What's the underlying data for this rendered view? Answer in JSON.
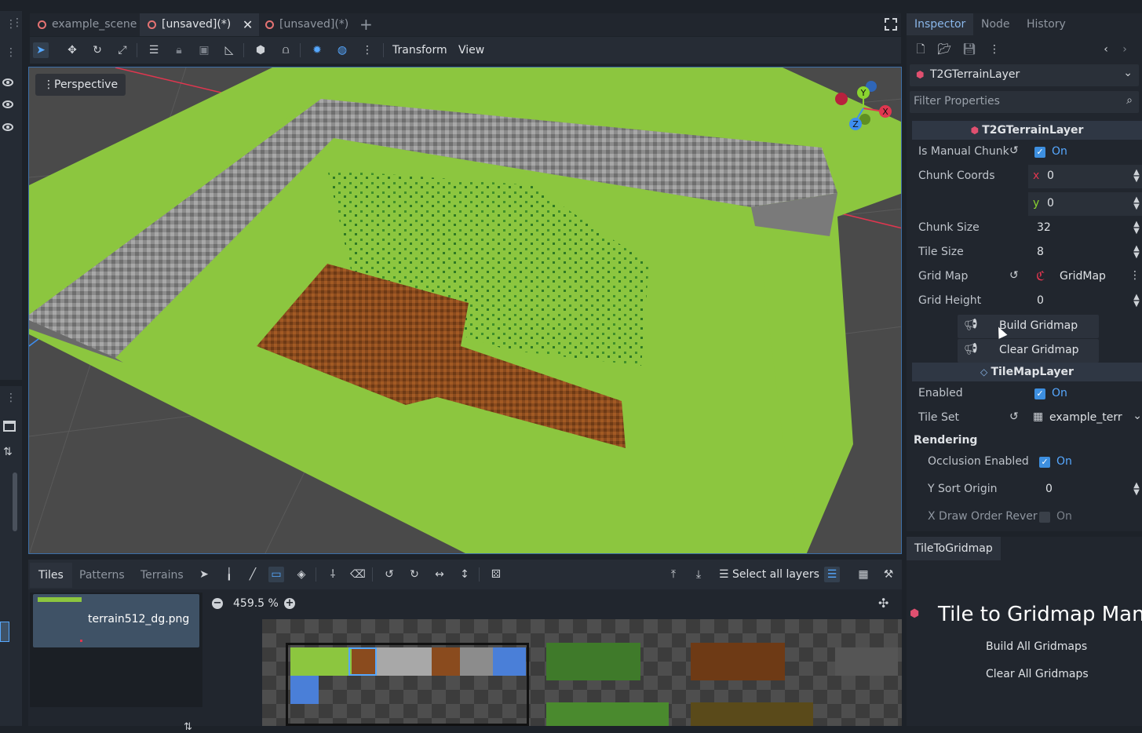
{
  "editor": {
    "scene_tabs": [
      "example_scene",
      "[unsaved](*)",
      "[unsaved](*)"
    ],
    "active_tab_index": 1,
    "toolbar_menus": [
      "Transform",
      "View"
    ],
    "viewport_mode": "Perspective",
    "gizmo_axes": [
      "Y",
      "X",
      "Z"
    ]
  },
  "bottom_panel": {
    "tabs": [
      "Tiles",
      "Patterns",
      "Terrains"
    ],
    "active_tab": "Tiles",
    "layers_button": "Select all layers",
    "atlas_name": "terrain512_dg.png",
    "zoom": "459.5 %"
  },
  "inspector": {
    "tabs": [
      "Inspector",
      "Node",
      "History"
    ],
    "active_tab": "Inspector",
    "object_name": "T2GTerrainLayer",
    "filter_placeholder": "Filter Properties",
    "section_main": "T2GTerrainLayer",
    "is_manual_chunk": {
      "label": "Is Manual Chunk",
      "value": "On"
    },
    "chunk_coords": {
      "label": "Chunk Coords",
      "x_label": "x",
      "x": "0",
      "y_label": "y",
      "y": "0"
    },
    "chunk_size": {
      "label": "Chunk Size",
      "value": "32"
    },
    "tile_size": {
      "label": "Tile Size",
      "value": "8"
    },
    "grid_map": {
      "label": "Grid Map",
      "value": "GridMap"
    },
    "grid_height": {
      "label": "Grid Height",
      "value": "0"
    },
    "build_button": "Build Gridmap",
    "clear_button": "Clear Gridmap",
    "section_tilemap": "TileMapLayer",
    "enabled": {
      "label": "Enabled",
      "value": "On"
    },
    "tile_set": {
      "label": "Tile Set",
      "value": "example_terr"
    },
    "rendering_group": "Rendering",
    "occlusion_enabled": {
      "label": "Occlusion Enabled",
      "value": "On"
    },
    "y_sort_origin": {
      "label": "Y Sort Origin",
      "value": "0"
    },
    "x_draw_order": {
      "label": "X Draw Order Rever",
      "value": "On"
    }
  },
  "plugin": {
    "tab": "TileToGridmap",
    "title": "Tile to Gridmap Manag",
    "build_all": "Build All Gridmaps",
    "clear_all": "Clear All Gridmaps"
  },
  "colors": {
    "accent": "#56a8ff",
    "grass": "#8cc63f",
    "dirt": "#8a4b1e",
    "stone": "#8c8c8c",
    "axis_x": "#e0364f",
    "axis_y": "#8ad42f",
    "axis_z": "#3e8ef0"
  }
}
